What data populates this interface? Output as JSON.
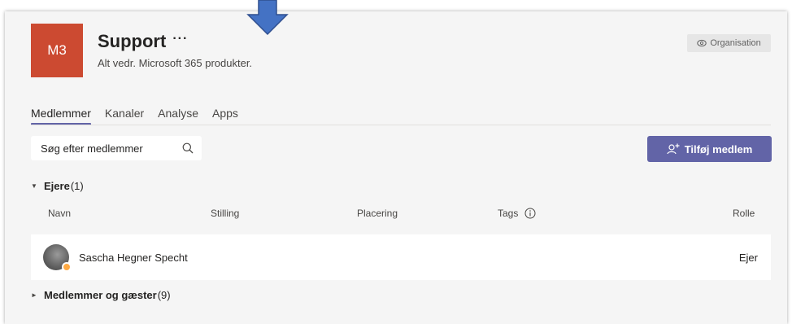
{
  "team": {
    "avatar_initials": "M3",
    "avatar_color": "#cc4a31",
    "name": "Support",
    "more_label": "···",
    "description": "Alt vedr. Microsoft 365 produkter.",
    "privacy_label": "Organisation"
  },
  "tabs": [
    {
      "label": "Medlemmer",
      "active": true
    },
    {
      "label": "Kanaler",
      "active": false
    },
    {
      "label": "Analyse",
      "active": false
    },
    {
      "label": "Apps",
      "active": false
    }
  ],
  "search": {
    "placeholder": "Søg efter medlemmer"
  },
  "add_member_label": "Tilføj medlem",
  "owners_section": {
    "title": "Ejere",
    "count": "(1)"
  },
  "columns": {
    "name": "Navn",
    "title": "Stilling",
    "location": "Placering",
    "tags": "Tags",
    "role": "Rolle"
  },
  "owners": [
    {
      "name": "Sascha Hegner Specht",
      "role": "Ejer",
      "presence_color": "#ffaa44"
    }
  ],
  "members_section": {
    "title": "Medlemmer og gæster",
    "count": "(9)"
  },
  "colors": {
    "accent": "#6264a7",
    "arrow": "#4472c4"
  }
}
